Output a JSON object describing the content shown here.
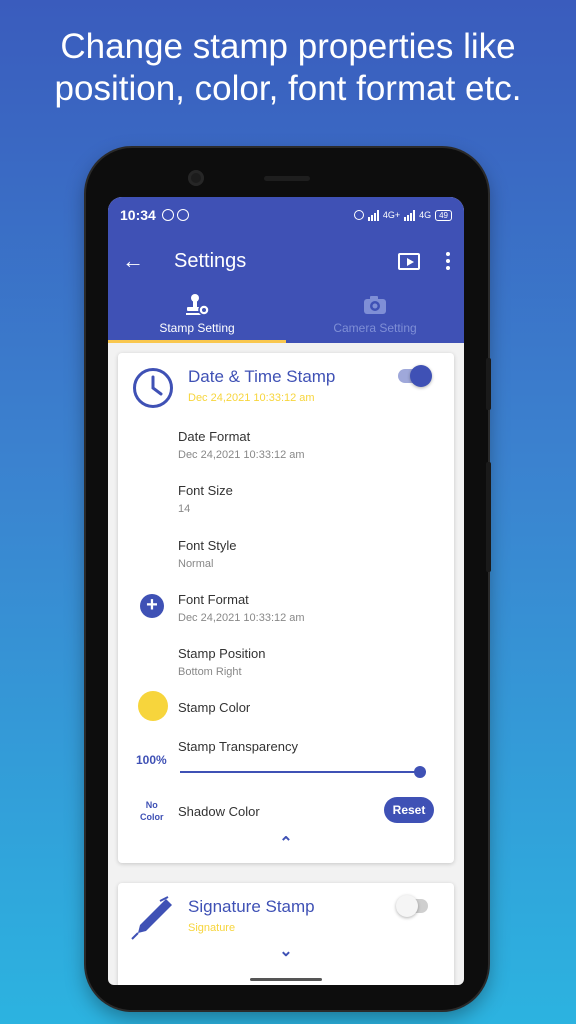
{
  "promo": {
    "line1": "Change stamp properties like",
    "line2": "position, color, font format etc."
  },
  "status_bar": {
    "time": "10:34",
    "net_label": "4G+",
    "net_label2": "4G",
    "battery": "49"
  },
  "app_bar": {
    "back_icon": "back-arrow-icon",
    "title": "Settings",
    "cast_icon": "cast-icon",
    "menu_icon": "more-vert-icon"
  },
  "tabs": [
    {
      "label": "Stamp Setting",
      "icon": "stamp-icon",
      "active": true
    },
    {
      "label": "Camera Setting",
      "icon": "camera-settings-icon",
      "active": false
    }
  ],
  "date_time_card": {
    "icon": "clock-icon",
    "title": "Date & Time Stamp",
    "subtitle": "Dec 24,2021 10:33:12 am",
    "enabled": true,
    "rows": {
      "date_format": {
        "label": "Date Format",
        "value": "Dec 24,2021 10:33:12 am"
      },
      "font_size": {
        "label": "Font Size",
        "value": "14"
      },
      "font_style": {
        "label": "Font Style",
        "value": "Normal"
      },
      "font_format": {
        "label": "Font Format",
        "value": "Dec 24,2021 10:33:12 am"
      },
      "stamp_position": {
        "label": "Stamp Position",
        "value": "Bottom Right"
      },
      "stamp_color": {
        "label": "Stamp Color",
        "color": "#f7d53c"
      },
      "stamp_transparency": {
        "label": "Stamp Transparency",
        "percent_text": "100%",
        "level": 1.0
      },
      "shadow_color": {
        "label": "Shadow Color",
        "no_color_line1": "No",
        "no_color_line2": "Color",
        "reset_label": "Reset"
      }
    },
    "collapse_icon": "chevron-up-icon"
  },
  "signature_card": {
    "icon": "pen-icon",
    "title": "Signature Stamp",
    "subtitle": "Signature",
    "enabled": false,
    "expand_icon": "chevron-down-icon"
  },
  "colors": {
    "primary": "#3f51b5",
    "accent_yellow": "#f7d53c",
    "tab_indicator": "#f9c74f"
  }
}
